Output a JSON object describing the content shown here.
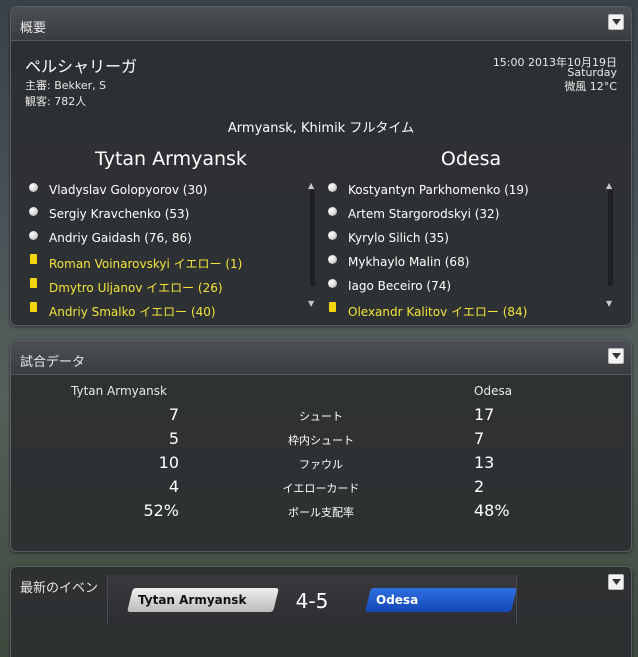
{
  "overview": {
    "title": "概要",
    "competition": "ペルシャリーガ",
    "referee": "主審: Bekker, S",
    "attendance": "観客: 782人",
    "datetime": "15:00 2013年10月19日",
    "weekday": "Saturday",
    "weather": "微風 12°C",
    "venue_status": "Armyansk, Khimik フルタイム",
    "home_team": "Tytan Armyansk",
    "away_team": "Odesa",
    "home_events": [
      {
        "type": "goal",
        "icon": "ball-icon",
        "text": "Vladyslav Golopyorov (30)"
      },
      {
        "type": "goal",
        "icon": "ball-icon",
        "text": "Sergiy Kravchenko (53)"
      },
      {
        "type": "goal",
        "icon": "ball-icon",
        "text": "Andriy Gaidash (76, 86)"
      },
      {
        "type": "yellow",
        "icon": "yellow-card-icon",
        "text": "Roman Voinarovskyi イエロー (1)"
      },
      {
        "type": "yellow",
        "icon": "yellow-card-icon",
        "text": "Dmytro Uljanov イエロー (26)"
      },
      {
        "type": "yellow",
        "icon": "yellow-card-icon",
        "text": "Andriy Smalko イエロー (40)"
      }
    ],
    "away_events": [
      {
        "type": "goal",
        "icon": "ball-icon",
        "text": "Kostyantyn Parkhomenko (19)"
      },
      {
        "type": "goal",
        "icon": "ball-icon",
        "text": "Artem Stargorodskyi (32)"
      },
      {
        "type": "goal",
        "icon": "ball-icon",
        "text": "Kyrylo Silich (35)"
      },
      {
        "type": "goal",
        "icon": "ball-icon",
        "text": "Mykhaylo Malin (68)"
      },
      {
        "type": "goal",
        "icon": "ball-icon",
        "text": "Iago Beceiro (74)"
      },
      {
        "type": "yellow",
        "icon": "yellow-card-icon",
        "text": "Olexandr Kalitov イエロー (84)"
      }
    ]
  },
  "stats": {
    "title": "試合データ",
    "home_team": "Tytan Armyansk",
    "away_team": "Odesa",
    "rows": [
      {
        "label": "シュート",
        "home": "7",
        "away": "17"
      },
      {
        "label": "枠内シュート",
        "home": "5",
        "away": "7"
      },
      {
        "label": "ファウル",
        "home": "10",
        "away": "13"
      },
      {
        "label": "イエローカード",
        "home": "4",
        "away": "2"
      },
      {
        "label": "ボール支配率",
        "home": "52%",
        "away": "48%"
      }
    ]
  },
  "latest": {
    "title": "最新のイベン",
    "home_team": "Tytan Armyansk",
    "away_team": "Odesa",
    "score": "4-5"
  },
  "colors": {
    "yellow_text": "#f3e33a",
    "yellow_card": "#f4d60a",
    "away_tab": "#1d56c9",
    "home_tab": "#d6d6d6"
  }
}
